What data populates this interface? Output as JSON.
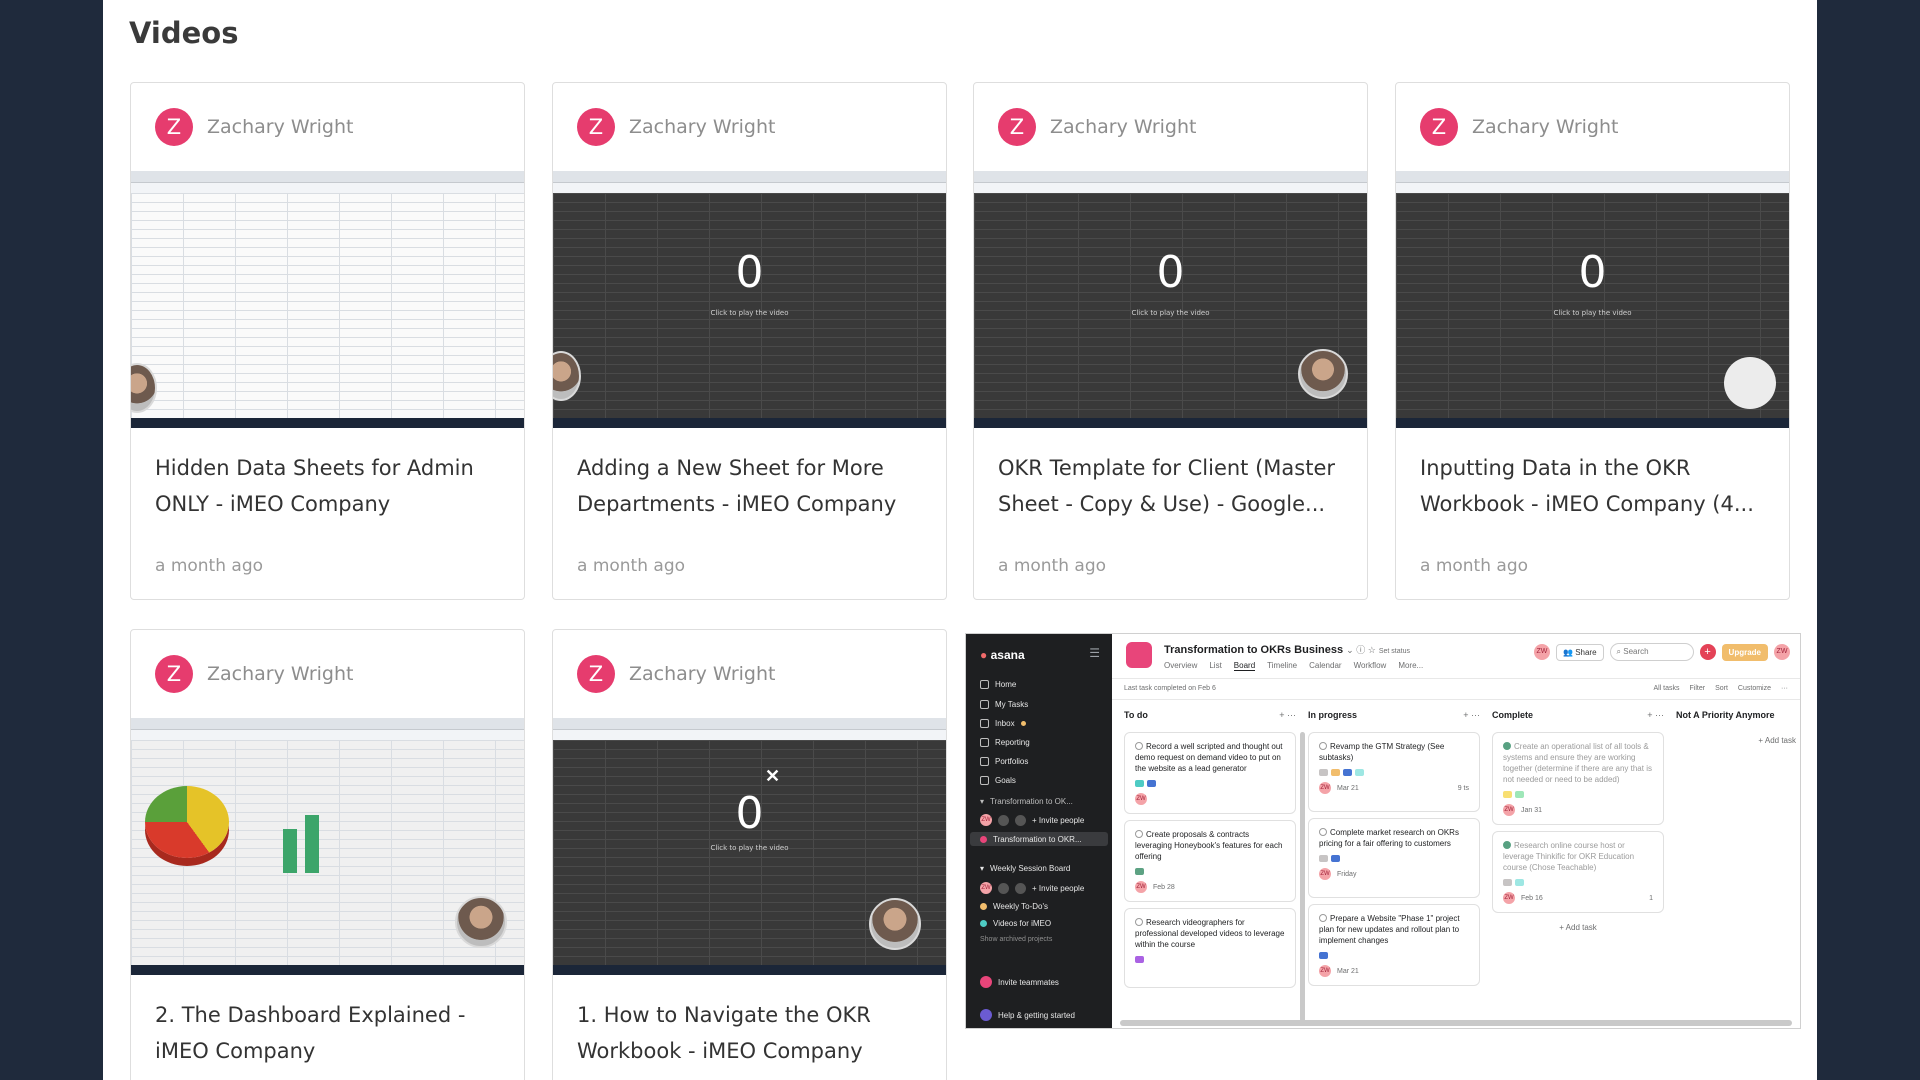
{
  "section_title": "Videos",
  "colors": {
    "avatar": "#e63c6e",
    "page_bg": "#1f2a3c",
    "asana_brand": "#e8457a",
    "upgrade": "#f1bd6c"
  },
  "cards": [
    {
      "avatar_letter": "Z",
      "author": "Zachary Wright",
      "title": "Hidden Data Sheets for Admin ONLY - iMEO Company",
      "meta": "a month ago"
    },
    {
      "avatar_letter": "Z",
      "author": "Zachary Wright",
      "title": "Adding a New Sheet for More Departments - iMEO Company",
      "meta": "a month ago",
      "overlay_value": "0",
      "overlay_text": "Click to play the video"
    },
    {
      "avatar_letter": "Z",
      "author": "Zachary Wright",
      "title": "OKR Template for Client (Master Sheet - Copy & Use) - Google...",
      "meta": "a month ago",
      "overlay_value": "0",
      "overlay_text": "Click to play the video"
    },
    {
      "avatar_letter": "Z",
      "author": "Zachary Wright",
      "title": "Inputting Data in the OKR Workbook - iMEO Company (4...",
      "meta": "a month ago",
      "overlay_value": "0",
      "overlay_text": "Click to play the video"
    },
    {
      "avatar_letter": "Z",
      "author": "Zachary Wright",
      "title": "2. The Dashboard Explained - iMEO Company"
    },
    {
      "avatar_letter": "Z",
      "author": "Zachary Wright",
      "title": "1. How to Navigate the OKR Workbook - iMEO Company",
      "overlay_value": "0",
      "overlay_text": "Click to play the video"
    }
  ],
  "asana": {
    "logo": "asana",
    "sidebar": {
      "items": [
        "Home",
        "My Tasks",
        "Inbox",
        "Reporting",
        "Portfolios",
        "Goals"
      ],
      "team1": "Transformation to OK...",
      "invite": "+ Invite people",
      "project1": "Transformation to OKR...",
      "team2": "Weekly Session Board",
      "invite2": "+ Invite people",
      "project2": "Weekly To-Do's",
      "project3": "Videos for iMEO",
      "archived": "Show archived projects",
      "invite_teammates": "Invite teammates",
      "help": "Help & getting started"
    },
    "project_title": "Transformation to OKRs Business",
    "set_status": "Set status",
    "tabs": [
      "Overview",
      "List",
      "Board",
      "Timeline",
      "Calendar",
      "Workflow",
      "More..."
    ],
    "share": "Share",
    "search_placeholder": "Search",
    "upgrade": "Upgrade",
    "user_initials": "ZW",
    "last_completed": "Last task completed on Feb 6",
    "toolbar": {
      "all_tasks": "All tasks",
      "filter": "Filter",
      "sort": "Sort",
      "customize": "Customize"
    },
    "columns": [
      {
        "name": "To do",
        "tasks": [
          {
            "text": "Record a well scripted and thought out demo request on demand video to put on the website as a lead generator",
            "due": ""
          },
          {
            "text": "Create proposals & contracts leveraging Honeybook's features for each offering",
            "due": "Feb 28"
          },
          {
            "text": "Research videographers for professional developed videos to leverage within the course",
            "due": ""
          }
        ]
      },
      {
        "name": "In progress",
        "tasks": [
          {
            "text": "Revamp the GTM Strategy (See subtasks)",
            "due": "Mar 21",
            "extra": "9 ts"
          },
          {
            "text": "Complete market research on OKRs pricing for a fair offering to customers",
            "due": "Friday"
          },
          {
            "text": "Prepare a Website \"Phase 1\" project plan for new updates and rollout plan to implement changes",
            "due": "Mar 21"
          }
        ]
      },
      {
        "name": "Complete",
        "tasks": [
          {
            "text": "Create an operational list of all tools & systems and ensure they are working together (determine if there are any that is not needed or need to be added)",
            "due": "Jan 31"
          },
          {
            "text": "Research online course host or leverage Thinkific for OKR Education course (Chose Teachable)",
            "due": "Feb 16",
            "extra": "1"
          }
        ],
        "add": "+ Add task"
      },
      {
        "name": "Not A Priority Anymore",
        "tasks": [],
        "add": "+ Add task"
      }
    ]
  }
}
